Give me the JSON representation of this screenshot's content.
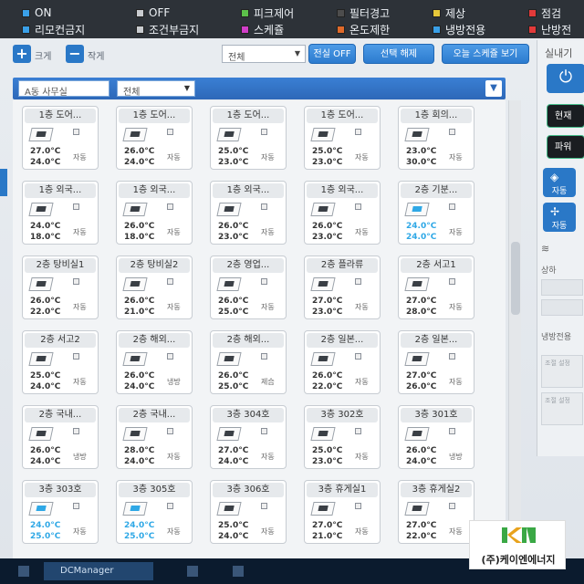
{
  "legend": [
    {
      "label": "ON",
      "color": "#3aa0e8"
    },
    {
      "label": "OFF",
      "color": "#c9ccd0"
    },
    {
      "label": "피크제어",
      "color": "#5cc04a"
    },
    {
      "label": "필터경고",
      "color": "#4d4d4d"
    },
    {
      "label": "제상",
      "color": "#e6c83a"
    },
    {
      "label": "점검",
      "color": "#e23a3a"
    },
    {
      "label": "리모컨금지",
      "color": "#3aa0e8"
    },
    {
      "label": "조건부금지",
      "color": "#c9ccd0"
    },
    {
      "label": "스케쥴",
      "color": "#d03ec8"
    },
    {
      "label": "온도제한",
      "color": "#e06a2a"
    },
    {
      "label": "냉방전용",
      "color": "#3aa0e8"
    },
    {
      "label": "난방전",
      "color": "#e23a3a"
    }
  ],
  "toolbar": {
    "plus_label": "크게",
    "minus_label": "작게",
    "filter_value": "전체",
    "btn_all_off": "전실 OFF",
    "btn_deselect": "선택 해제",
    "btn_schedule_view": "오늘 스케쥴 보기"
  },
  "zone": {
    "building": "A동 사무실",
    "floor": "전체",
    "collapse_icon": "chevron-down-icon"
  },
  "units": [
    {
      "name": "1층 도어...",
      "t1": "27.0°C",
      "t2": "24.0°C",
      "mode": "자동",
      "status": "on"
    },
    {
      "name": "1층 도어...",
      "t1": "26.0°C",
      "t2": "24.0°C",
      "mode": "자동",
      "status": "on"
    },
    {
      "name": "1층 도어...",
      "t1": "25.0°C",
      "t2": "23.0°C",
      "mode": "자동",
      "status": "on"
    },
    {
      "name": "1층 도어...",
      "t1": "25.0°C",
      "t2": "23.0°C",
      "mode": "자동",
      "status": "on"
    },
    {
      "name": "1층 회의...",
      "t1": "23.0°C",
      "t2": "30.0°C",
      "mode": "자동",
      "status": "on"
    },
    {
      "name": "1층 외국...",
      "t1": "24.0°C",
      "t2": "18.0°C",
      "mode": "자동",
      "status": "on"
    },
    {
      "name": "1층 외국...",
      "t1": "26.0°C",
      "t2": "18.0°C",
      "mode": "자동",
      "status": "on"
    },
    {
      "name": "1층 외국...",
      "t1": "26.0°C",
      "t2": "23.0°C",
      "mode": "자동",
      "status": "on"
    },
    {
      "name": "1층 외국...",
      "t1": "26.0°C",
      "t2": "23.0°C",
      "mode": "자동",
      "status": "on"
    },
    {
      "name": "2층 기분...",
      "t1": "24.0°C",
      "t2": "24.0°C",
      "mode": "자동",
      "status": "cool"
    },
    {
      "name": "2층 탕비실1",
      "t1": "26.0°C",
      "t2": "22.0°C",
      "mode": "자동",
      "status": "on"
    },
    {
      "name": "2층 탕비실2",
      "t1": "26.0°C",
      "t2": "21.0°C",
      "mode": "자동",
      "status": "on"
    },
    {
      "name": "2층 영업...",
      "t1": "26.0°C",
      "t2": "25.0°C",
      "mode": "자동",
      "status": "on"
    },
    {
      "name": "2층 플라류",
      "t1": "27.0°C",
      "t2": "23.0°C",
      "mode": "자동",
      "status": "on"
    },
    {
      "name": "2층 서고1",
      "t1": "27.0°C",
      "t2": "28.0°C",
      "mode": "자동",
      "status": "on"
    },
    {
      "name": "2층 서고2",
      "t1": "25.0°C",
      "t2": "24.0°C",
      "mode": "자동",
      "status": "on"
    },
    {
      "name": "2층 해외...",
      "t1": "26.0°C",
      "t2": "24.0°C",
      "mode": "냉방",
      "status": "on"
    },
    {
      "name": "2층 해외...",
      "t1": "26.0°C",
      "t2": "25.0°C",
      "mode": "제습",
      "status": "on"
    },
    {
      "name": "2층 일본...",
      "t1": "26.0°C",
      "t2": "22.0°C",
      "mode": "자동",
      "status": "on"
    },
    {
      "name": "2층 일본...",
      "t1": "27.0°C",
      "t2": "26.0°C",
      "mode": "자동",
      "status": "on"
    },
    {
      "name": "2층 국내...",
      "t1": "26.0°C",
      "t2": "24.0°C",
      "mode": "냉방",
      "status": "on"
    },
    {
      "name": "2층 국내...",
      "t1": "28.0°C",
      "t2": "24.0°C",
      "mode": "자동",
      "status": "on"
    },
    {
      "name": "3층 304호",
      "t1": "27.0°C",
      "t2": "24.0°C",
      "mode": "자동",
      "status": "on"
    },
    {
      "name": "3층 302호",
      "t1": "25.0°C",
      "t2": "23.0°C",
      "mode": "자동",
      "status": "on"
    },
    {
      "name": "3층 301호",
      "t1": "26.0°C",
      "t2": "24.0°C",
      "mode": "냉방",
      "status": "on"
    },
    {
      "name": "3층 303호",
      "t1": "24.0°C",
      "t2": "25.0°C",
      "mode": "자동",
      "status": "cool"
    },
    {
      "name": "3층 305호",
      "t1": "24.0°C",
      "t2": "25.0°C",
      "mode": "자동",
      "status": "cool"
    },
    {
      "name": "3층 306호",
      "t1": "25.0°C",
      "t2": "24.0°C",
      "mode": "자동",
      "status": "on"
    },
    {
      "name": "3층 휴게실1",
      "t1": "27.0°C",
      "t2": "21.0°C",
      "mode": "자동",
      "status": "on"
    },
    {
      "name": "3층 휴게실2",
      "t1": "27.0°C",
      "t2": "22.0°C",
      "mode": "자동",
      "status": "on"
    }
  ],
  "right_panel": {
    "title": "실내기",
    "power_icon": "power-icon",
    "btn_current": "현재",
    "btn_wind": "파워",
    "mode_auto_1": "자동",
    "mode_auto_2": "자동",
    "swing_label": "상하",
    "cool_only": "냉방전용",
    "disabled_hint_1": "조절 설정",
    "disabled_hint_2": "조절 설정"
  },
  "taskbar": {
    "app_label": "DCManager"
  },
  "logo": {
    "mark": "KN",
    "name": "(주)케이엔에너지"
  }
}
